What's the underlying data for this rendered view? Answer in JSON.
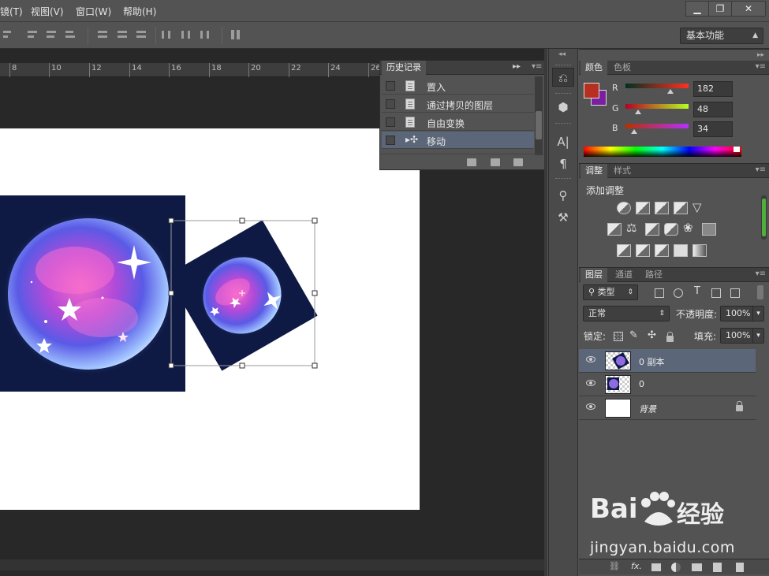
{
  "menu": {
    "items": [
      "镜(T)",
      "视图(V)",
      "窗口(W)",
      "帮助(H)"
    ]
  },
  "window_controls": {
    "minimize": "▁",
    "restore": "❐",
    "close": "✕"
  },
  "options_bar": {
    "workspace": "基本功能"
  },
  "ruler": {
    "labels": [
      "8",
      "10",
      "12",
      "14",
      "16",
      "18",
      "20",
      "22",
      "24",
      "26"
    ]
  },
  "history_panel": {
    "tab": "历史记录",
    "items": [
      {
        "label": "置入",
        "selected": false
      },
      {
        "label": "通过拷贝的图层",
        "selected": false
      },
      {
        "label": "自由变换",
        "selected": false
      },
      {
        "label": "移动",
        "selected": true
      }
    ]
  },
  "color_panel": {
    "tabs": [
      "颜色",
      "色板"
    ],
    "foreground": "#b63022",
    "background": "#7a1fa0",
    "channels": [
      {
        "name": "R",
        "value": "182"
      },
      {
        "name": "G",
        "value": "48"
      },
      {
        "name": "B",
        "value": "34"
      }
    ]
  },
  "adjustments_panel": {
    "tabs": [
      "调整",
      "样式"
    ],
    "title": "添加调整"
  },
  "layers_panel": {
    "tabs": [
      "图层",
      "通道",
      "路径"
    ],
    "filter": "类型",
    "blend_mode": "正常",
    "opacity_label": "不透明度:",
    "opacity_value": "100%",
    "lock_label": "锁定:",
    "fill_label": "填充:",
    "fill_value": "100%",
    "layers": [
      {
        "name": "0 副本",
        "selected": true,
        "locked": false
      },
      {
        "name": "0",
        "selected": false,
        "locked": false
      },
      {
        "name": "背景",
        "selected": false,
        "locked": true
      }
    ],
    "footer_fx": "fx."
  },
  "watermark": {
    "brand_left": "Bai",
    "brand_right": "经验",
    "url": "jingyan.baidu.com"
  }
}
